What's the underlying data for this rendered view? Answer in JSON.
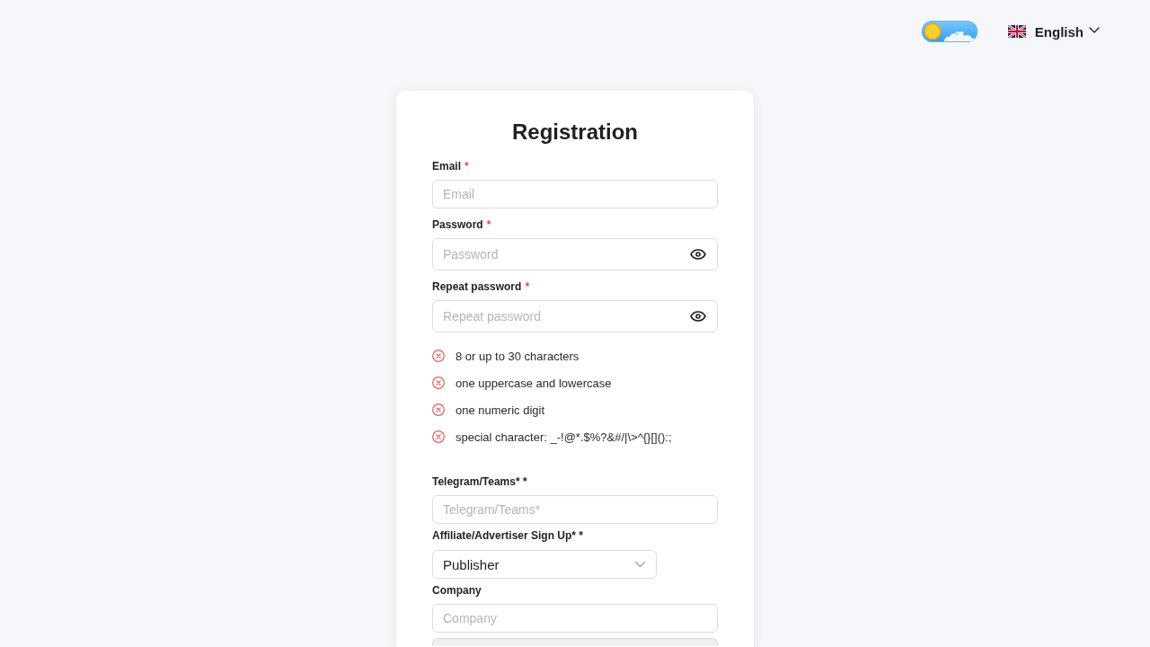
{
  "header": {
    "theme_toggle": {
      "dark": false
    },
    "language": {
      "label": "English"
    }
  },
  "form": {
    "title": "Registration",
    "fields": [
      {
        "kind": "text",
        "label": "Email",
        "required_mark": "*",
        "placeholder": "Email"
      },
      {
        "kind": "password",
        "label": "Password",
        "required_mark": "*",
        "placeholder": "Password"
      },
      {
        "kind": "password",
        "label": "Repeat password",
        "required_mark": "*",
        "placeholder": "Repeat password"
      }
    ],
    "password_rules": [
      {
        "text": "8 or up to 30 characters",
        "met": false
      },
      {
        "text": "one uppercase and lowercase",
        "met": false
      },
      {
        "text": "one numeric digit",
        "met": false
      },
      {
        "text": "special character: _-!@*.$%?&#/|\\>^{}[]():;",
        "met": false
      }
    ],
    "more_fields": [
      {
        "kind": "text",
        "label": "Telegram/Teams* *",
        "placeholder": "Telegram/Teams*"
      },
      {
        "kind": "select",
        "label": "Affiliate/Advertiser Sign Up* *",
        "value": "Publisher"
      },
      {
        "kind": "text",
        "label": "Company",
        "placeholder": "Company"
      },
      {
        "kind": "blank",
        "disabled": true
      }
    ]
  }
}
